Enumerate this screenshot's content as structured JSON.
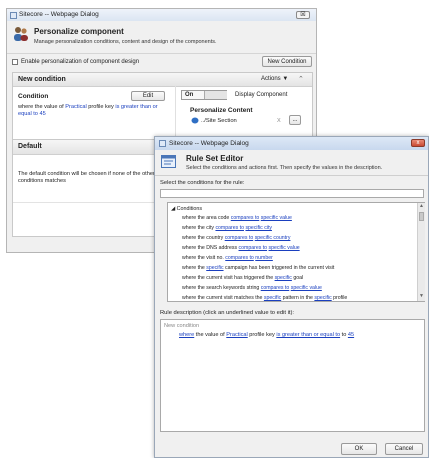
{
  "back_dialog": {
    "window_title": "Sitecore -- Webpage Dialog",
    "close_label": "☒",
    "header_title": "Personalize component",
    "header_subtitle": "Manage personalization conditions, content and design of the components.",
    "enable_design_label": "Enable personalization of component design",
    "new_condition_button": "New Condition",
    "new_condition_panel": {
      "title": "New condition",
      "actions_label": "Actions ▼",
      "condition_heading": "Condition",
      "edit_button": "Edit",
      "condition_text_prefix": "where the value of ",
      "condition_key": "Practical",
      "condition_text_mid": " profile key ",
      "condition_operator": "is greater than or equal to",
      "condition_value": "45",
      "toggle_on": "On",
      "display_component_label": "Display Component",
      "personalize_content_label": "Personalize Content",
      "content_path": "../Site Section",
      "clear_label": "X",
      "browse_label": "..."
    },
    "default_panel": {
      "title": "Default",
      "description": "The default condition will be chosen if none of the other conditions matches"
    }
  },
  "front_dialog": {
    "window_title": "Sitecore -- Webpage Dialog",
    "close_label": "x",
    "header_title": "Rule Set Editor",
    "header_subtitle": "Select the conditions and actions first. Then specify the values in the description.",
    "select_label": "Select the conditions for the rule:",
    "search_value": "",
    "conditions_group": "Conditions",
    "conditions": [
      {
        "pre": "where the area code ",
        "l1": "compares to",
        "mid": " ",
        "l2": "specific value",
        "post": ""
      },
      {
        "pre": "where the city ",
        "l1": "compares to",
        "mid": " ",
        "l2": "specific city",
        "post": ""
      },
      {
        "pre": "where the country ",
        "l1": "compares to",
        "mid": " ",
        "l2": "specific country",
        "post": ""
      },
      {
        "pre": "where the DNS address ",
        "l1": "compares to",
        "mid": " ",
        "l2": "specific value",
        "post": ""
      },
      {
        "pre": "where the visit no. ",
        "l1": "compares to",
        "mid": " ",
        "l2": "number",
        "post": ""
      },
      {
        "pre": "where the ",
        "l1": "specific",
        "mid": " campaign has been triggered in the current visit",
        "l2": "",
        "post": ""
      },
      {
        "pre": "where the current visit has triggered the ",
        "l1": "specific",
        "mid": " goal",
        "l2": "",
        "post": ""
      },
      {
        "pre": "where the search keywords string ",
        "l1": "compares to",
        "mid": " ",
        "l2": "specific value",
        "post": ""
      },
      {
        "pre": "where the current visit matches the ",
        "l1": "specific",
        "mid": " pattern in the ",
        "l2": "specific",
        "post": " profile"
      }
    ],
    "description_label": "Rule description (click an underlined value to edit it):",
    "rule_name": "New condition",
    "rule": {
      "where": "where",
      "text1": " the value of ",
      "key": "Practical",
      "text2": " profile key ",
      "operator": "is greater than or equal to",
      "value": "45"
    },
    "ok_button": "OK",
    "cancel_button": "Cancel"
  }
}
